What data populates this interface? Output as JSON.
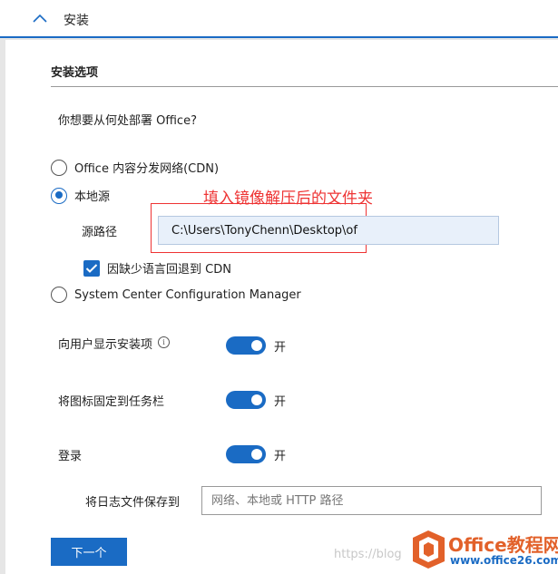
{
  "header": {
    "title": "安装"
  },
  "section": {
    "title": "安装选项"
  },
  "question": "你想要从何处部署 Office?",
  "radios": {
    "cdn": "Office 内容分发网络(CDN)",
    "local": "本地源",
    "sccm": "System Center Configuration Manager"
  },
  "annotation": "填入镜像解压后的文件夹",
  "source": {
    "label": "源路径",
    "value": "C:\\Users\\TonyChenn\\Desktop\\of"
  },
  "fallback": {
    "label": "因缺少语言回退到 CDN"
  },
  "toggles": {
    "show_install": "向用户显示安装项",
    "pin_taskbar": "将图标固定到任务栏",
    "logging": "登录",
    "state_on": "开"
  },
  "log": {
    "label": "将日志文件保存到",
    "placeholder": "网络、本地或 HTTP 路径"
  },
  "next_button": "下一个",
  "watermark": {
    "text": "https://blog",
    "brand": "Office教程网",
    "site": "www.office26.com"
  },
  "colors": {
    "accent": "#1a6bc4",
    "annotation": "#e33333",
    "logo_orange": "#e2612a"
  }
}
